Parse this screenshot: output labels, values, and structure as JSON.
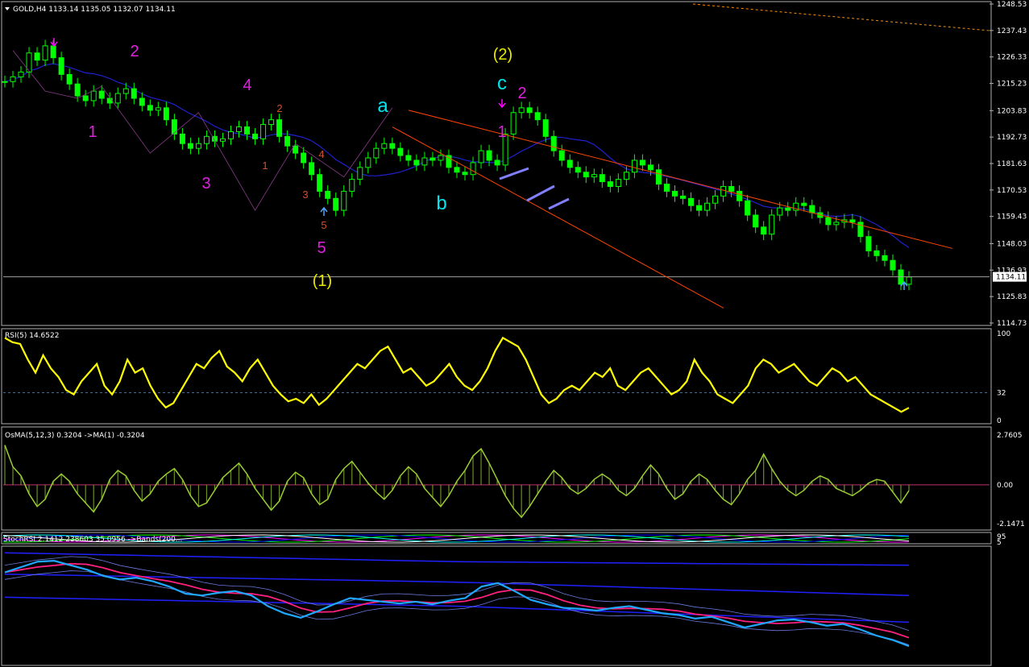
{
  "colors": {
    "background": "#000000",
    "axis": "#b0b0b0",
    "price_candles": "#00ff00",
    "ma": "#2020d0",
    "rsi": "#ffff00",
    "osma_line": "#9acd32",
    "osma_hist": "#6b8e23",
    "level_dash": "#4a6a8a",
    "channel": "#ff4500",
    "arrow_down": "#ff00ff",
    "arrow_up": "#4fa6ff",
    "arrow_blue": "#8080ff"
  },
  "chart_data": [
    {
      "pane": "price",
      "type": "candlestick",
      "title": "GOLD,H4  1133.14 1135.05 1132.07 1134.11",
      "ylim": [
        1114.73,
        1248.53
      ],
      "y_ticks": [
        "1248.53",
        "1237.43",
        "1226.33",
        "1215.23",
        "1203.83",
        "1192.73",
        "1181.63",
        "1170.53",
        "1159.43",
        "1148.03",
        "1136.93",
        "1125.83",
        "1114.73"
      ],
      "current_price": "1134.11",
      "close_series_approx": [
        1216,
        1218,
        1220,
        1228,
        1225,
        1231,
        1226,
        1219,
        1215,
        1210,
        1208,
        1212,
        1209,
        1207,
        1211,
        1213,
        1209,
        1206,
        1204,
        1205,
        1200,
        1194,
        1190,
        1188,
        1190,
        1193,
        1191,
        1192,
        1195,
        1197,
        1194,
        1192,
        1198,
        1200,
        1193,
        1189,
        1186,
        1182,
        1177,
        1170,
        1167,
        1162,
        1170,
        1175,
        1180,
        1184,
        1188,
        1190,
        1188,
        1185,
        1183,
        1181,
        1184,
        1183,
        1185,
        1180,
        1178,
        1177,
        1182,
        1187,
        1183,
        1181,
        1194,
        1203,
        1205,
        1203,
        1200,
        1193,
        1187,
        1183,
        1180,
        1178,
        1176,
        1177,
        1174,
        1172,
        1175,
        1178,
        1183,
        1181,
        1179,
        1173,
        1170,
        1168,
        1167,
        1164,
        1162,
        1165,
        1168,
        1172,
        1170,
        1166,
        1160,
        1155,
        1152,
        1160,
        1163,
        1162,
        1165,
        1164,
        1161,
        1159,
        1156,
        1157,
        1158,
        1157,
        1151,
        1145,
        1143,
        1141,
        1137,
        1131,
        1134
      ]
    },
    {
      "pane": "rsi",
      "type": "line",
      "title": "RSI(5) 14.6522",
      "ylim": [
        0,
        100
      ],
      "y_ticks": [
        "100",
        "32",
        "0"
      ],
      "level": 32,
      "values_approx": [
        95,
        90,
        88,
        70,
        55,
        75,
        60,
        50,
        35,
        30,
        45,
        55,
        65,
        40,
        30,
        45,
        70,
        55,
        60,
        40,
        25,
        15,
        20,
        35,
        50,
        65,
        60,
        72,
        80,
        62,
        55,
        45,
        60,
        70,
        55,
        40,
        30,
        22,
        25,
        20,
        30,
        18,
        25,
        35,
        45,
        55,
        65,
        60,
        70,
        80,
        85,
        70,
        55,
        60,
        50,
        40,
        45,
        55,
        65,
        50,
        40,
        35,
        45,
        60,
        80,
        95,
        90,
        85,
        70,
        50,
        30,
        20,
        25,
        35,
        40,
        35,
        45,
        55,
        50,
        60,
        40,
        35,
        45,
        55,
        60,
        50,
        40,
        30,
        35,
        45,
        70,
        55,
        45,
        30,
        25,
        20,
        30,
        40,
        60,
        70,
        65,
        55,
        60,
        65,
        55,
        45,
        40,
        50,
        60,
        55,
        45,
        50,
        40,
        30,
        25,
        20,
        15,
        10,
        14.65
      ]
    },
    {
      "pane": "osma",
      "type": "histogram",
      "title": "OsMA(5,12,3) 0.3204 ->MA(1) -0.3204",
      "ylim": [
        -2.1471,
        2.7605
      ],
      "y_ticks": [
        "2.7605",
        "0.00",
        "-2.1471"
      ],
      "values_approx": [
        2.2,
        1.0,
        0.5,
        -0.5,
        -1.2,
        -0.8,
        0.2,
        0.6,
        0.2,
        -0.5,
        -1.0,
        -1.5,
        -0.8,
        0.3,
        0.8,
        0.5,
        -0.3,
        -0.9,
        -0.5,
        0.2,
        0.6,
        0.9,
        0.3,
        -0.6,
        -1.2,
        -1.0,
        -0.3,
        0.4,
        0.8,
        1.2,
        0.6,
        -0.2,
        -0.8,
        -1.4,
        -0.9,
        0.2,
        0.7,
        0.4,
        -0.5,
        -1.1,
        -0.8,
        0.3,
        0.9,
        1.3,
        0.7,
        0.1,
        -0.4,
        -0.8,
        -0.3,
        0.5,
        1.0,
        0.6,
        -0.2,
        -0.7,
        -1.2,
        -0.6,
        0.2,
        0.8,
        1.6,
        2.0,
        1.2,
        0.3,
        -0.6,
        -1.3,
        -1.8,
        -1.2,
        -0.5,
        0.2,
        0.8,
        0.4,
        -0.2,
        -0.5,
        -0.2,
        0.3,
        0.6,
        0.3,
        -0.3,
        -0.6,
        -0.2,
        0.5,
        1.1,
        0.6,
        -0.2,
        -0.8,
        -0.5,
        0.2,
        0.6,
        0.3,
        -0.3,
        -0.8,
        -1.1,
        -0.5,
        0.3,
        0.8,
        1.7,
        0.9,
        0.2,
        -0.3,
        -0.6,
        -0.3,
        0.2,
        0.5,
        0.3,
        -0.2,
        -0.4,
        -0.6,
        -0.3,
        0.1,
        0.3,
        0.2,
        -0.4,
        -1.0,
        -0.32
      ]
    },
    {
      "pane": "stochrsi_strip",
      "type": "line",
      "title": "StochRSI 2.1412 238603 35.0956 ->Bands(200...",
      "y_ticks": [
        "95",
        "5"
      ]
    },
    {
      "pane": "bands",
      "type": "line",
      "series_names": [],
      "price_approx": [
        1216,
        1222,
        1228,
        1229,
        1224,
        1219,
        1212,
        1208,
        1210,
        1206,
        1200,
        1192,
        1190,
        1193,
        1195,
        1190,
        1178,
        1170,
        1165,
        1172,
        1180,
        1187,
        1185,
        1183,
        1181,
        1183,
        1180,
        1184,
        1187,
        1200,
        1204,
        1195,
        1185,
        1180,
        1176,
        1175,
        1173,
        1176,
        1178,
        1174,
        1170,
        1168,
        1164,
        1166,
        1160,
        1154,
        1158,
        1162,
        1163,
        1160,
        1156,
        1158,
        1152,
        1145,
        1140,
        1133
      ]
    }
  ],
  "wave_labels": {
    "magenta": [
      {
        "text": "1",
        "x_bar": 8,
        "price": 1192
      },
      {
        "text": "2",
        "x_bar": 12,
        "price": 1227
      },
      {
        "text": "3",
        "x_bar": 19,
        "price": 1170
      },
      {
        "text": "4",
        "x_bar": 24,
        "price": 1211
      },
      {
        "text": "5",
        "x_bar": 31,
        "price": 1143
      },
      {
        "text": "1",
        "x_bar": 47,
        "price": 1191
      },
      {
        "text": "2",
        "x_bar": 50,
        "price": 1210
      }
    ],
    "orange_small": [
      {
        "text": "2",
        "x_bar": 27,
        "price": 1203
      },
      {
        "text": "1",
        "x_bar": 25,
        "price": 1178
      },
      {
        "text": "4",
        "x_bar": 30,
        "price": 1184
      },
      {
        "text": "3",
        "x_bar": 29,
        "price": 1166
      },
      {
        "text": "5",
        "x_bar": 31,
        "price": 1154
      }
    ],
    "cyan": [
      {
        "text": "a",
        "x_bar": 36,
        "price": 1203
      },
      {
        "text": "b",
        "x_bar": 42,
        "price": 1161
      },
      {
        "text": "c",
        "x_bar": 48,
        "price": 1210
      }
    ],
    "yellow": [
      {
        "text": "(2)",
        "x_bar": 48,
        "price": 1225
      },
      {
        "text": "(1)",
        "x_bar": 30,
        "price": 1132
      }
    ]
  }
}
